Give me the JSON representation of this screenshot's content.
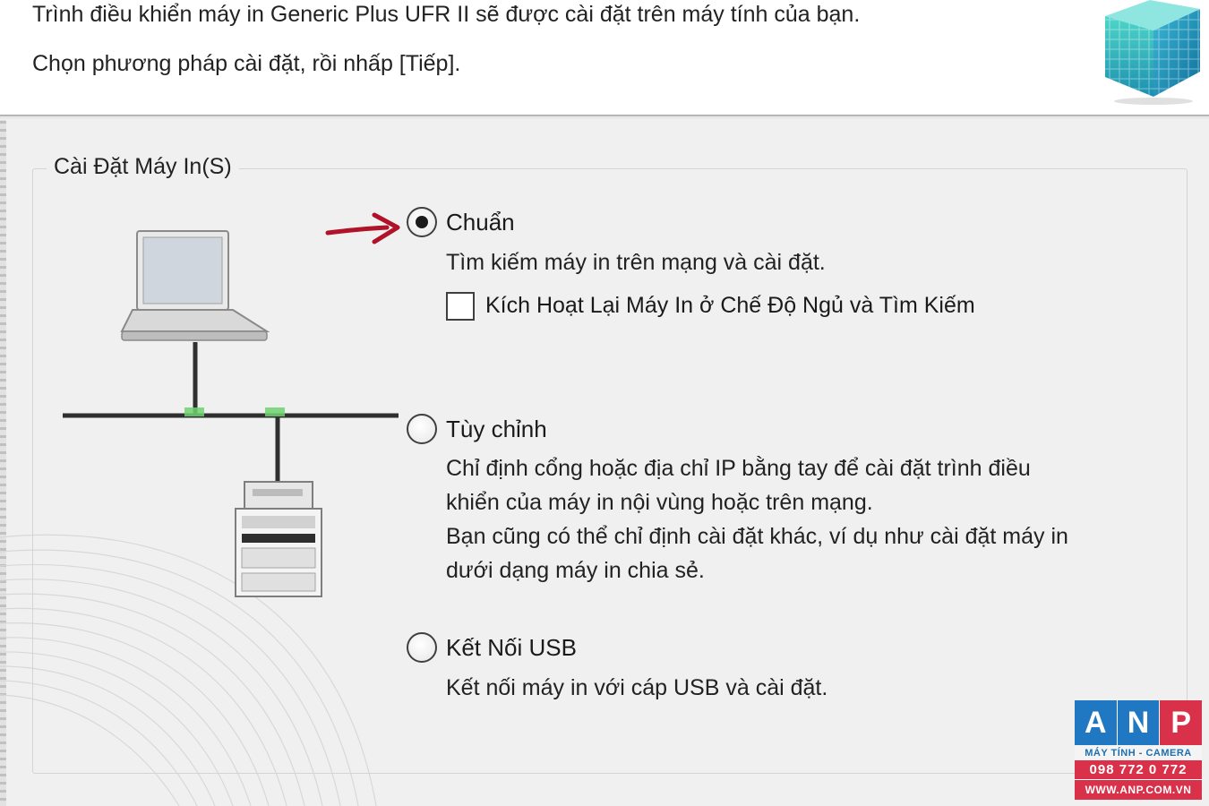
{
  "header": {
    "intro_line_1": "Trình điều khiển máy in Generic Plus UFR II sẽ được cài đặt trên máy tính của bạn.",
    "intro_line_2": "Chọn phương pháp cài đặt, rồi nhấp [Tiếp]."
  },
  "group": {
    "title": "Cài Đặt Máy In(S)"
  },
  "options": {
    "standard": {
      "label": "Chuẩn",
      "selected": true,
      "description": "Tìm kiếm máy in trên mạng và cài đặt.",
      "checkbox_label": "Kích Hoạt Lại Máy In ở Chế Độ Ngủ và Tìm Kiếm",
      "checkbox_checked": false
    },
    "custom": {
      "label": "Tùy chỉnh",
      "selected": false,
      "description_lines": [
        "Chỉ định cổng hoặc địa chỉ IP bằng tay để cài đặt trình điều",
        "khiển của máy in nội vùng hoặc trên mạng.",
        "Bạn cũng có thể chỉ định cài đặt khác, ví dụ như cài đặt máy in",
        "dưới dạng máy in chia sẻ."
      ]
    },
    "usb": {
      "label": "Kết Nối USB",
      "selected": false,
      "description": "Kết nối máy in với cáp USB và cài đặt."
    }
  },
  "watermark": {
    "letters": [
      "A",
      "N",
      "P"
    ],
    "letter_colors": [
      "#1f78c1",
      "#1f78c1",
      "#d9314a"
    ],
    "tagline": "MÁY TÍNH - CAMERA",
    "phone": "098 772 0 772",
    "website": "WWW.ANP.COM.VN"
  },
  "colors": {
    "arrow": "#b0122a",
    "network_port": "#6fd36f"
  }
}
